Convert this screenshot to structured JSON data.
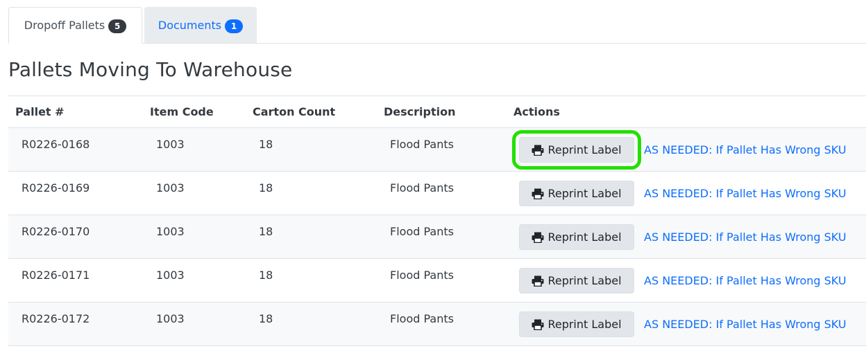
{
  "tabs": [
    {
      "label": "Dropoff Pallets",
      "badge": "5",
      "active": true
    },
    {
      "label": "Documents",
      "badge": "1",
      "active": false
    }
  ],
  "page_title": "Pallets Moving To Warehouse",
  "table": {
    "headers": [
      "Pallet #",
      "Item Code",
      "Carton Count",
      "Description",
      "Actions"
    ],
    "rows": [
      {
        "pallet": "R0226-0168",
        "item_code": "1003",
        "carton_count": "18",
        "description": "Flood Pants"
      },
      {
        "pallet": "R0226-0169",
        "item_code": "1003",
        "carton_count": "18",
        "description": "Flood Pants"
      },
      {
        "pallet": "R0226-0170",
        "item_code": "1003",
        "carton_count": "18",
        "description": "Flood Pants"
      },
      {
        "pallet": "R0226-0171",
        "item_code": "1003",
        "carton_count": "18",
        "description": "Flood Pants"
      },
      {
        "pallet": "R0226-0172",
        "item_code": "1003",
        "carton_count": "18",
        "description": "Flood Pants"
      }
    ]
  },
  "actions": {
    "reprint_label": "Reprint Label",
    "reprint_icon": "printer-icon",
    "wrong_sku_link": "AS NEEDED: If Pallet Has Wrong SKU"
  },
  "colors": {
    "link": "#0d6efd",
    "highlight": "#22e000",
    "badge_dark": "#343a40",
    "badge_primary": "#0d6efd"
  }
}
